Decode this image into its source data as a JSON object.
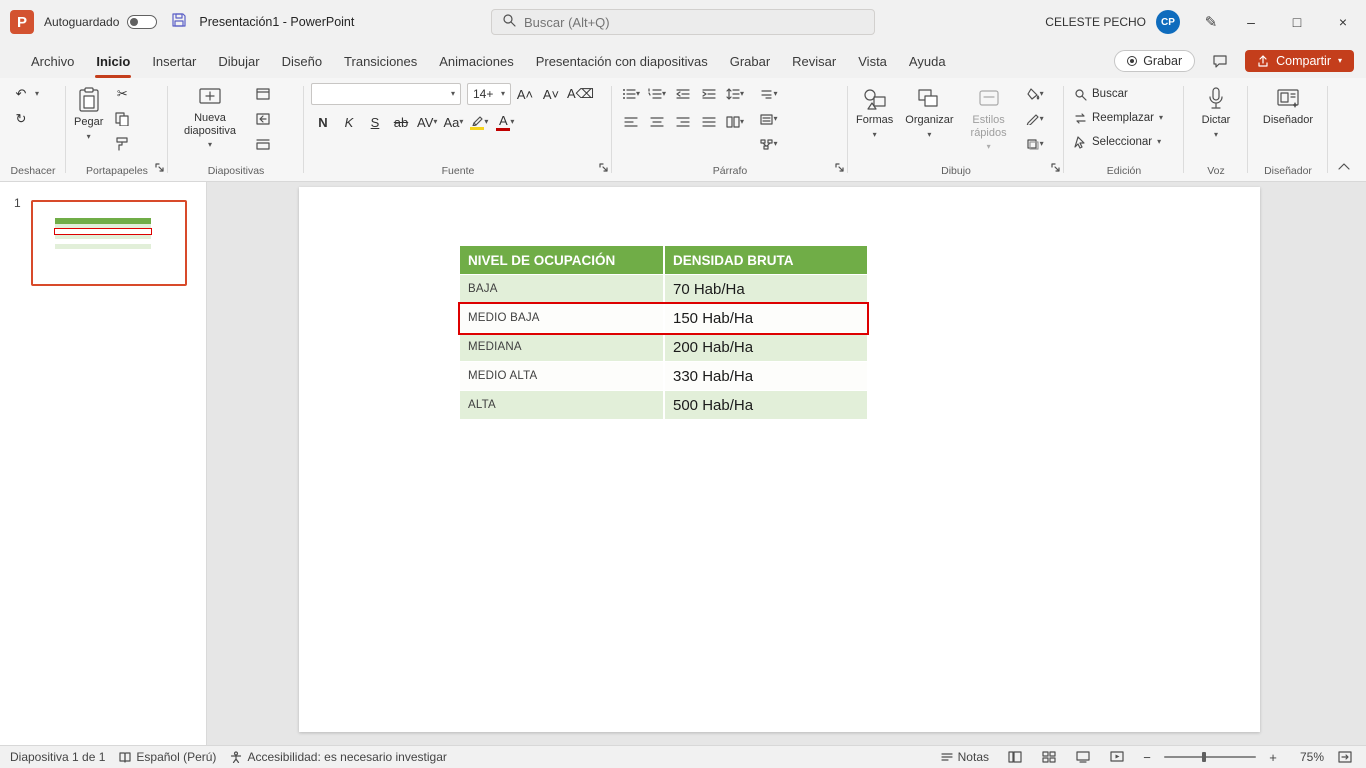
{
  "titlebar": {
    "autosave_label": "Autoguardado",
    "window_title": "Presentación1  -  PowerPoint",
    "search_placeholder": "Buscar (Alt+Q)",
    "user_name": "CELESTE PECHO",
    "user_initials": "CP"
  },
  "tabs": {
    "items": [
      "Archivo",
      "Inicio",
      "Insertar",
      "Dibujar",
      "Diseño",
      "Transiciones",
      "Animaciones",
      "Presentación con diapositivas",
      "Grabar",
      "Revisar",
      "Vista",
      "Ayuda"
    ],
    "active": "Inicio"
  },
  "topright": {
    "grabar_button": "Grabar",
    "compartir_button": "Compartir"
  },
  "ribbon": {
    "group_labels": [
      "Deshacer",
      "Portapapeles",
      "Diapositivas",
      "Fuente",
      "Párrafo",
      "Dibujo",
      "Edición",
      "Voz",
      "Diseñador"
    ],
    "pegar": "Pegar",
    "nueva_diapositiva": "Nueva diapositiva",
    "font_name": "",
    "font_size": "14+",
    "bold": "N",
    "italic": "K",
    "underline": "S",
    "strikethrough": "ab",
    "spacing": "AV",
    "case_btn": "Aa",
    "color_letter": "A",
    "formas": "Formas",
    "organizar": "Organizar",
    "estilos_rapidos": "Estilos rápidos",
    "buscar": "Buscar",
    "reemplazar": "Reemplazar",
    "seleccionar": "Seleccionar",
    "dictar": "Dictar",
    "disenador": "Diseñador"
  },
  "panel": {
    "slide_number": "1"
  },
  "slide": {
    "table": {
      "headers": [
        "NIVEL DE OCUPACIÓN",
        "DENSIDAD BRUTA"
      ],
      "rows": [
        {
          "nivel": "BAJA",
          "densidad": "70 Hab/Ha"
        },
        {
          "nivel": "MEDIO BAJA",
          "densidad": "150 Hab/Ha"
        },
        {
          "nivel": "MEDIANA",
          "densidad": "200 Hab/Ha"
        },
        {
          "nivel": "MEDIO ALTA",
          "densidad": "330 Hab/Ha"
        },
        {
          "nivel": "ALTA",
          "densidad": "500 Hab/Ha"
        }
      ],
      "selected_row": "MEDIO BAJA"
    }
  },
  "statusbar": {
    "slide_info": "Diapositiva 1 de 1",
    "language": "Español (Perú)",
    "accessibility": "Accesibilidad: es necesario investigar",
    "notes_label": "Notas",
    "zoom_level": "75%"
  },
  "icons": {
    "chevron_down": "▾",
    "undo": "↶",
    "redo": "↻",
    "scissors": "✂",
    "minimize": "–",
    "maximize": "□",
    "close": "×",
    "pen": "✎",
    "grow_font": "A˄",
    "shrink_font": "A˅",
    "clear_format": "A⌫",
    "zoom_minus": "−",
    "zoom_plus": "+"
  },
  "colors": {
    "accent": "#c43e1c",
    "table_header_green": "#70ad47",
    "band_green": "#e2efd9",
    "selection_red": "#dd0000"
  }
}
